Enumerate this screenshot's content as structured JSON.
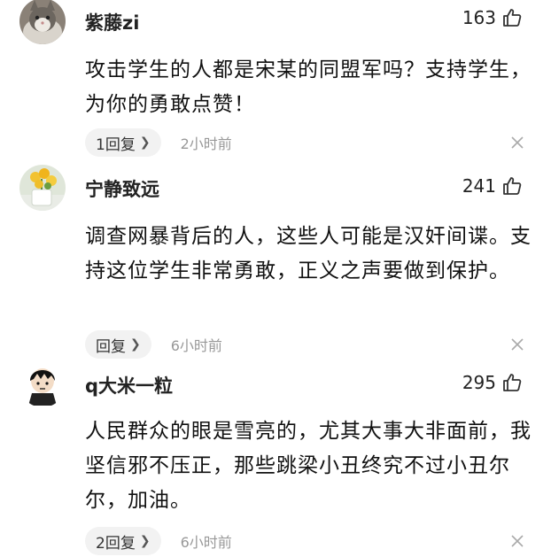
{
  "comments": [
    {
      "username": "紫藤zi",
      "likes": "163",
      "text": "攻击学生的人都是宋某的同盟军吗？支持学生，为你的勇敢点赞！",
      "reply_label": "1回复",
      "time": "2小时前",
      "avatar": "cat-avatar"
    },
    {
      "username": "宁静致远",
      "likes": "241",
      "text": "调查网暴背后的人，这些人可能是汉奸间谍。支持这位学生非常勇敢，正义之声要做到保护。",
      "reply_label": "回复",
      "time": "6小时前",
      "avatar": "flower-avatar"
    },
    {
      "username": "q大米一粒",
      "likes": "295",
      "text": "人民群众的眼是雪亮的，尤其大事大非面前，我坚信邪不压正，那些跳梁小丑终究不过小丑尔尔，加油。",
      "reply_label": "2回复",
      "time": "6小时前",
      "avatar": "cartoon-avatar"
    }
  ],
  "icons": {
    "like": "thumbs-up-icon",
    "close": "close-icon",
    "chevron": "chevron-right-icon"
  }
}
